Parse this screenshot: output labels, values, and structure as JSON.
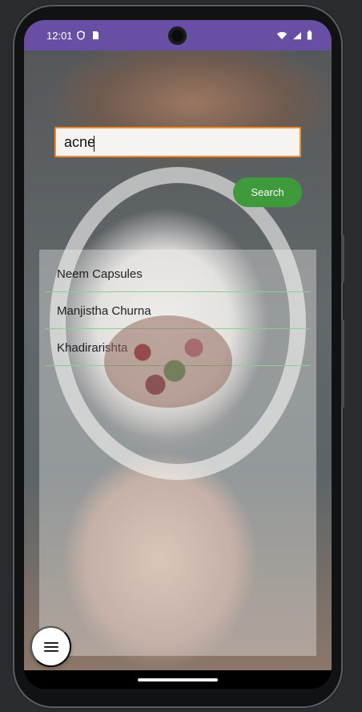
{
  "status_bar": {
    "time": "12:01",
    "left_icons": [
      "shield-icon",
      "sd-card-icon"
    ],
    "right_icons": [
      "wifi-icon",
      "signal-icon",
      "battery-icon"
    ],
    "color": "#6750a4"
  },
  "search": {
    "value": "acne",
    "button_label": "Search",
    "border_color": "#ec8b2f",
    "button_color": "#3f9a3c"
  },
  "results": {
    "items": [
      {
        "label": "Neem Capsules"
      },
      {
        "label": "Manjistha Churna"
      },
      {
        "label": "Khadirarishta"
      }
    ],
    "divider_color": "#8dcf8e"
  },
  "navigation": {
    "menu_icon": "hamburger-menu-icon",
    "home_indicator": "home-indicator"
  },
  "background": {
    "image_subject": "mortar-and-pestle-with-dried-herbs"
  }
}
